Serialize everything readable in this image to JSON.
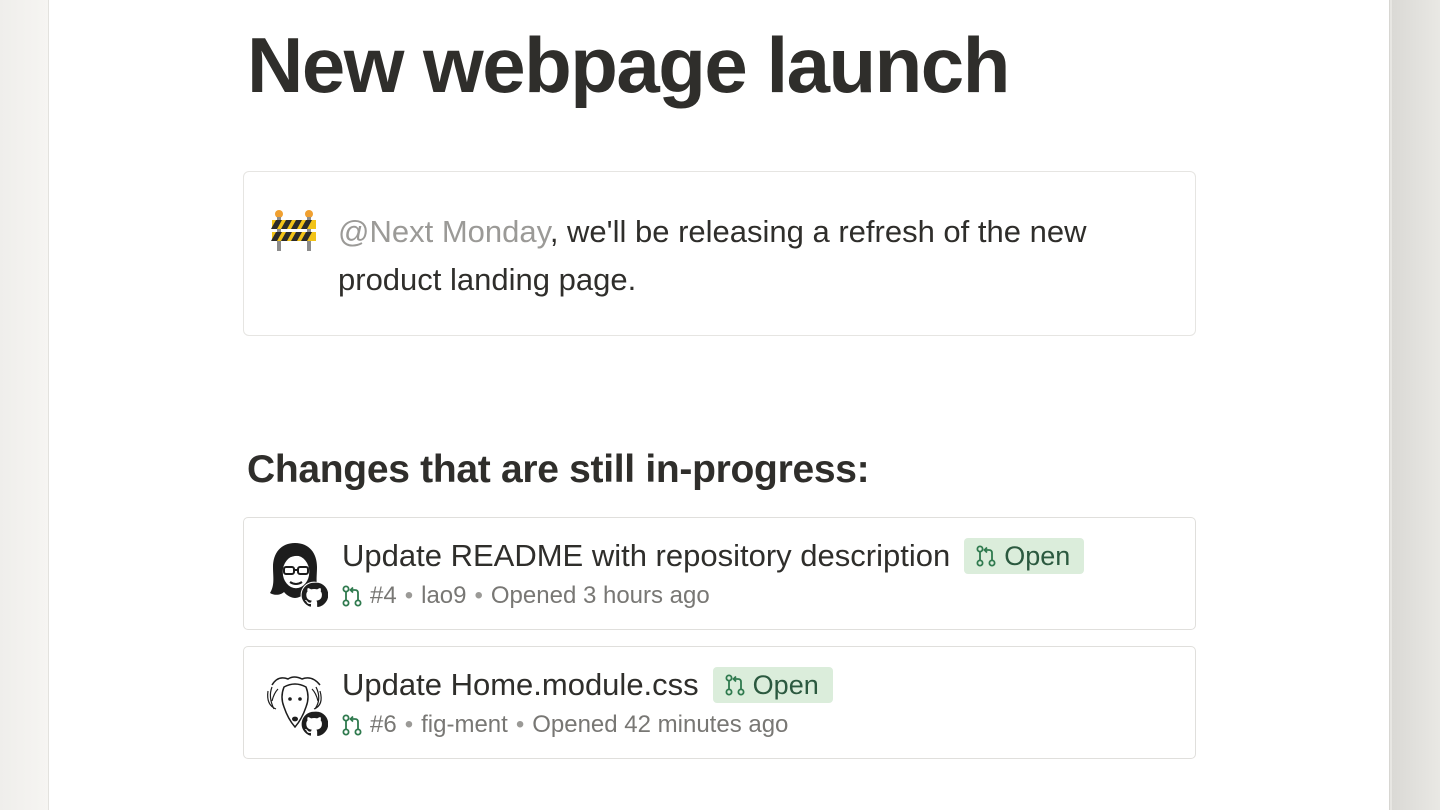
{
  "page": {
    "title": "New webpage launch"
  },
  "callout": {
    "icon": "construction-barrier-icon",
    "mention": "@Next Monday",
    "text": ", we'll be releasing a refresh of the new product landing page."
  },
  "section": {
    "heading": "Changes that are still in-progress:"
  },
  "pull_requests": [
    {
      "title": "Update README with repository description",
      "status": "Open",
      "number": "#4",
      "author": "lao9",
      "opened": "Opened 3 hours ago",
      "avatar": "woman-with-glasses-avatar"
    },
    {
      "title": "Update Home.module.css",
      "status": "Open",
      "number": "#6",
      "author": "fig-ment",
      "opened": "Opened 42 minutes ago",
      "avatar": "dog-avatar"
    }
  ],
  "meta": {
    "separator": "•"
  },
  "colors": {
    "open_badge_bg": "#dbeddb",
    "open_badge_text": "#2b593f",
    "pr_icon_green": "#2f7a4e",
    "mention_gray": "#9b9a97"
  }
}
